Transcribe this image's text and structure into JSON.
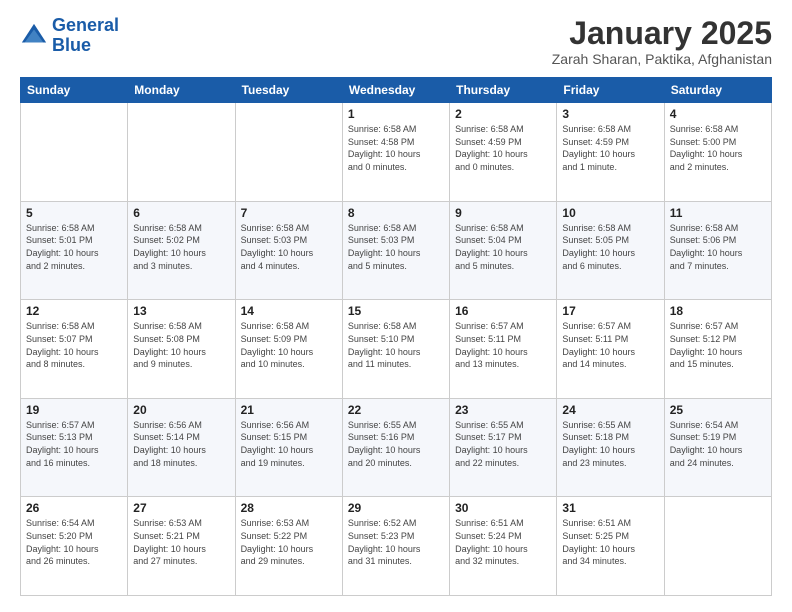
{
  "logo": {
    "line1": "General",
    "line2": "Blue"
  },
  "header": {
    "title": "January 2025",
    "subtitle": "Zarah Sharan, Paktika, Afghanistan"
  },
  "weekdays": [
    "Sunday",
    "Monday",
    "Tuesday",
    "Wednesday",
    "Thursday",
    "Friday",
    "Saturday"
  ],
  "weeks": [
    [
      {
        "day": "",
        "info": ""
      },
      {
        "day": "",
        "info": ""
      },
      {
        "day": "",
        "info": ""
      },
      {
        "day": "1",
        "info": "Sunrise: 6:58 AM\nSunset: 4:58 PM\nDaylight: 10 hours\nand 0 minutes."
      },
      {
        "day": "2",
        "info": "Sunrise: 6:58 AM\nSunset: 4:59 PM\nDaylight: 10 hours\nand 0 minutes."
      },
      {
        "day": "3",
        "info": "Sunrise: 6:58 AM\nSunset: 4:59 PM\nDaylight: 10 hours\nand 1 minute."
      },
      {
        "day": "4",
        "info": "Sunrise: 6:58 AM\nSunset: 5:00 PM\nDaylight: 10 hours\nand 2 minutes."
      }
    ],
    [
      {
        "day": "5",
        "info": "Sunrise: 6:58 AM\nSunset: 5:01 PM\nDaylight: 10 hours\nand 2 minutes."
      },
      {
        "day": "6",
        "info": "Sunrise: 6:58 AM\nSunset: 5:02 PM\nDaylight: 10 hours\nand 3 minutes."
      },
      {
        "day": "7",
        "info": "Sunrise: 6:58 AM\nSunset: 5:03 PM\nDaylight: 10 hours\nand 4 minutes."
      },
      {
        "day": "8",
        "info": "Sunrise: 6:58 AM\nSunset: 5:03 PM\nDaylight: 10 hours\nand 5 minutes."
      },
      {
        "day": "9",
        "info": "Sunrise: 6:58 AM\nSunset: 5:04 PM\nDaylight: 10 hours\nand 5 minutes."
      },
      {
        "day": "10",
        "info": "Sunrise: 6:58 AM\nSunset: 5:05 PM\nDaylight: 10 hours\nand 6 minutes."
      },
      {
        "day": "11",
        "info": "Sunrise: 6:58 AM\nSunset: 5:06 PM\nDaylight: 10 hours\nand 7 minutes."
      }
    ],
    [
      {
        "day": "12",
        "info": "Sunrise: 6:58 AM\nSunset: 5:07 PM\nDaylight: 10 hours\nand 8 minutes."
      },
      {
        "day": "13",
        "info": "Sunrise: 6:58 AM\nSunset: 5:08 PM\nDaylight: 10 hours\nand 9 minutes."
      },
      {
        "day": "14",
        "info": "Sunrise: 6:58 AM\nSunset: 5:09 PM\nDaylight: 10 hours\nand 10 minutes."
      },
      {
        "day": "15",
        "info": "Sunrise: 6:58 AM\nSunset: 5:10 PM\nDaylight: 10 hours\nand 11 minutes."
      },
      {
        "day": "16",
        "info": "Sunrise: 6:57 AM\nSunset: 5:11 PM\nDaylight: 10 hours\nand 13 minutes."
      },
      {
        "day": "17",
        "info": "Sunrise: 6:57 AM\nSunset: 5:11 PM\nDaylight: 10 hours\nand 14 minutes."
      },
      {
        "day": "18",
        "info": "Sunrise: 6:57 AM\nSunset: 5:12 PM\nDaylight: 10 hours\nand 15 minutes."
      }
    ],
    [
      {
        "day": "19",
        "info": "Sunrise: 6:57 AM\nSunset: 5:13 PM\nDaylight: 10 hours\nand 16 minutes."
      },
      {
        "day": "20",
        "info": "Sunrise: 6:56 AM\nSunset: 5:14 PM\nDaylight: 10 hours\nand 18 minutes."
      },
      {
        "day": "21",
        "info": "Sunrise: 6:56 AM\nSunset: 5:15 PM\nDaylight: 10 hours\nand 19 minutes."
      },
      {
        "day": "22",
        "info": "Sunrise: 6:55 AM\nSunset: 5:16 PM\nDaylight: 10 hours\nand 20 minutes."
      },
      {
        "day": "23",
        "info": "Sunrise: 6:55 AM\nSunset: 5:17 PM\nDaylight: 10 hours\nand 22 minutes."
      },
      {
        "day": "24",
        "info": "Sunrise: 6:55 AM\nSunset: 5:18 PM\nDaylight: 10 hours\nand 23 minutes."
      },
      {
        "day": "25",
        "info": "Sunrise: 6:54 AM\nSunset: 5:19 PM\nDaylight: 10 hours\nand 24 minutes."
      }
    ],
    [
      {
        "day": "26",
        "info": "Sunrise: 6:54 AM\nSunset: 5:20 PM\nDaylight: 10 hours\nand 26 minutes."
      },
      {
        "day": "27",
        "info": "Sunrise: 6:53 AM\nSunset: 5:21 PM\nDaylight: 10 hours\nand 27 minutes."
      },
      {
        "day": "28",
        "info": "Sunrise: 6:53 AM\nSunset: 5:22 PM\nDaylight: 10 hours\nand 29 minutes."
      },
      {
        "day": "29",
        "info": "Sunrise: 6:52 AM\nSunset: 5:23 PM\nDaylight: 10 hours\nand 31 minutes."
      },
      {
        "day": "30",
        "info": "Sunrise: 6:51 AM\nSunset: 5:24 PM\nDaylight: 10 hours\nand 32 minutes."
      },
      {
        "day": "31",
        "info": "Sunrise: 6:51 AM\nSunset: 5:25 PM\nDaylight: 10 hours\nand 34 minutes."
      },
      {
        "day": "",
        "info": ""
      }
    ]
  ]
}
